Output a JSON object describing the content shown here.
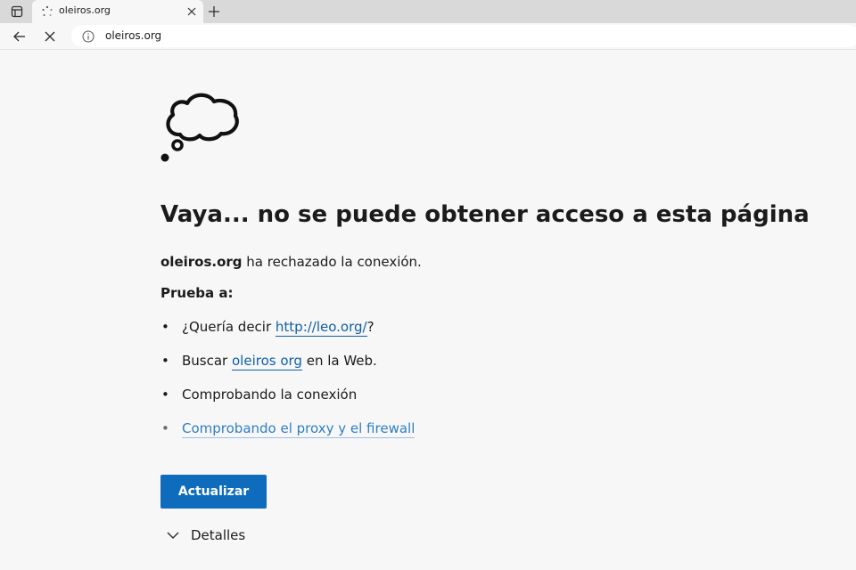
{
  "browser": {
    "tab": {
      "title": "oleiros.org"
    },
    "address_bar": {
      "url": "oleiros.org"
    },
    "icons": {
      "tab_actions": "tab-actions-icon",
      "loading": "loading-spinner-icon",
      "close_tab": "close-icon",
      "new_tab": "plus-icon",
      "back": "back-arrow-icon",
      "stop": "stop-x-icon",
      "site_info": "info-icon"
    }
  },
  "error_page": {
    "illustration": "thought-cloud-icon",
    "headline": "Vaya... no se puede obtener acceso a esta página",
    "refused": {
      "host": "oleiros.org",
      "message": " ha rechazado la conexión."
    },
    "try_label": "Prueba a:",
    "suggestions": {
      "s1_prefix": "¿Quería decir ",
      "s1_link": "http://leo.org/",
      "s1_suffix": "?",
      "s2_prefix": "Buscar ",
      "s2_link": "oleiros org",
      "s2_suffix": " en la Web.",
      "s3_text": "Comprobando la conexión",
      "s4_link": "Comprobando el proxy y el firewall"
    },
    "bullet": "•",
    "refresh_button": "Actualizar",
    "details_label": "Detalles"
  },
  "colors": {
    "accent": "#0f6cbd",
    "link": "#0f5fa8",
    "background": "#f7f7f7",
    "tabstrip": "#d9d9d9"
  }
}
